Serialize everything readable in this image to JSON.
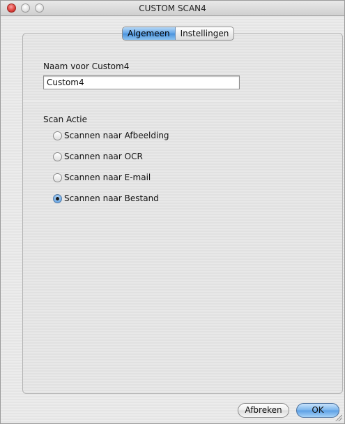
{
  "window": {
    "title": "CUSTOM SCAN4"
  },
  "tabs": [
    {
      "label": "Algemeen",
      "active": true
    },
    {
      "label": "Instellingen",
      "active": false
    }
  ],
  "name_section": {
    "label": "Naam voor Custom4",
    "value": "Custom4"
  },
  "scan_action": {
    "heading": "Scan Actie",
    "options": [
      {
        "label": "Scannen naar Afbeelding",
        "selected": false
      },
      {
        "label": "Scannen naar OCR",
        "selected": false
      },
      {
        "label": "Scannen naar E-mail",
        "selected": false
      },
      {
        "label": "Scannen naar Bestand",
        "selected": true
      }
    ]
  },
  "buttons": {
    "cancel": "Afbreken",
    "ok": "OK"
  },
  "colors": {
    "accent": "#5b9ee4",
    "close": "#e0443f"
  }
}
